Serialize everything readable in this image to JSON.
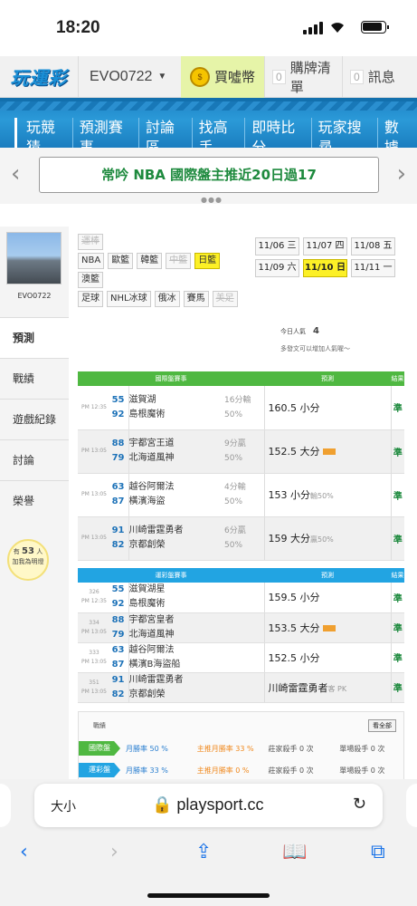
{
  "status": {
    "time": "18:20"
  },
  "site": {
    "logo": "玩運彩",
    "account": "EVO0722",
    "coin": "買噓幣",
    "coin_icon": "coin",
    "boards": [
      {
        "count": "0",
        "label": "購牌清單"
      },
      {
        "count": "0",
        "label": "訊息"
      }
    ]
  },
  "menu": [
    "玩競猜",
    "預測賽事",
    "討論區",
    "找高手",
    "即時比分",
    "玩家搜尋",
    "數據"
  ],
  "banner": {
    "text": "常吟 NBA 國際盤主推近20日過17"
  },
  "profile": {
    "name": "EVO0722",
    "nav": [
      "預測",
      "戰績",
      "遊戲紀錄",
      "討論",
      "榮譽"
    ],
    "fans_prefix": "有",
    "fans_count": "53",
    "fans_suffix": "人",
    "fans_note": "加我為明燈"
  },
  "filters": {
    "rows": [
      [
        {
          "label": "運棒",
          "state": "dis"
        }
      ],
      [
        {
          "label": "NBA",
          "state": ""
        },
        {
          "label": "歐籃",
          "state": ""
        },
        {
          "label": "韓籃",
          "state": ""
        },
        {
          "label": "中籃",
          "state": "dis"
        },
        {
          "label": "日籃",
          "state": "on"
        }
      ],
      [
        {
          "label": "澳籃",
          "state": ""
        }
      ],
      [
        {
          "label": "足球",
          "state": ""
        },
        {
          "label": "NHL冰球",
          "state": ""
        },
        {
          "label": "俄冰",
          "state": ""
        },
        {
          "label": "賽馬",
          "state": ""
        },
        {
          "label": "美足",
          "state": "dis"
        }
      ]
    ],
    "dates": [
      {
        "label": "11/06 三",
        "on": false
      },
      {
        "label": "11/07 四",
        "on": false
      },
      {
        "label": "11/08 五",
        "on": false
      },
      {
        "label": "11/09 六",
        "on": false
      },
      {
        "label": "11/10 日",
        "on": true
      },
      {
        "label": "11/11 一",
        "on": false
      }
    ],
    "popular_label": "今日人氣",
    "popular_value": "4",
    "note": "多發文可以增加人氣喔～"
  },
  "intl": {
    "headers": [
      "國際盤賽事",
      "預測",
      "結果"
    ],
    "rows": [
      {
        "time": "PM 12:35",
        "n1": "55",
        "t1": "滋賀湖",
        "n2": "92",
        "t2": "島根魔術",
        "h1": "16分輸",
        "h2": "50%",
        "pick": "160.5 小分",
        "sub": "",
        "tag": false,
        "res": "準"
      },
      {
        "time": "PM 13:05",
        "n1": "88",
        "t1": "宇都宮王道",
        "n2": "79",
        "t2": "北海道風神",
        "h1": "9分贏",
        "h2": "50%",
        "pick": "152.5 大分",
        "sub": "",
        "tag": true,
        "res": "準"
      },
      {
        "time": "PM 13:05",
        "n1": "63",
        "t1": "越谷阿爾法",
        "n2": "87",
        "t2": "橫濱海盜",
        "h1": "4分輸",
        "h2": "50%",
        "pick": "153 小分",
        "sub": "輸50%",
        "tag": false,
        "res": "準"
      },
      {
        "time": "PM 13:05",
        "n1": "91",
        "t1": "川崎雷霆勇者",
        "n2": "82",
        "t2": "京都創榮",
        "h1": "6分贏",
        "h2": "50%",
        "pick": "159 大分",
        "sub": "贏50%",
        "tag": false,
        "res": "準"
      }
    ]
  },
  "lottery": {
    "headers": [
      "運彩盤賽事",
      "預測",
      "結果"
    ],
    "rows": [
      {
        "code": "326",
        "time": "PM 12:35",
        "n1": "55",
        "t1": "滋賀湖星",
        "n2": "92",
        "t2": "島根魔術",
        "pick": "159.5 小分",
        "sub": "",
        "tag": false,
        "res": "準"
      },
      {
        "code": "334",
        "time": "PM 13:05",
        "n1": "88",
        "t1": "宇都宮皇者",
        "n2": "79",
        "t2": "北海道風神",
        "pick": "153.5 大分",
        "sub": "",
        "tag": true,
        "res": "準"
      },
      {
        "code": "333",
        "time": "PM 13:05",
        "n1": "63",
        "t1": "越谷阿爾法",
        "n2": "87",
        "t2": "橫濱B海盜船",
        "pick": "152.5 小分",
        "sub": "",
        "tag": false,
        "res": "準"
      },
      {
        "code": "351",
        "time": "PM 13:05",
        "n1": "91",
        "t1": "川崎雷霆勇者",
        "n2": "82",
        "t2": "京都創榮",
        "pick": "川崎雷霆勇者",
        "sub": "客 PK",
        "tag": false,
        "res": "準"
      }
    ]
  },
  "record": {
    "title": "戰績",
    "all": "看全部",
    "rows": [
      {
        "label": "國際盤",
        "color": "#4fb841",
        "cells": [
          "月勝率 50 %",
          "主推月勝率 33 %",
          "莊家殺手 0 次",
          "單場殺手 0 次"
        ]
      },
      {
        "label": "運彩盤",
        "color": "#22a4e2",
        "cells": [
          "月勝率 33 %",
          "主推月勝率 0 %",
          "莊家殺手 0 次",
          "單場殺手 0 次"
        ]
      }
    ]
  },
  "browser": {
    "text_size": "大小",
    "host": "playsport.cc"
  }
}
